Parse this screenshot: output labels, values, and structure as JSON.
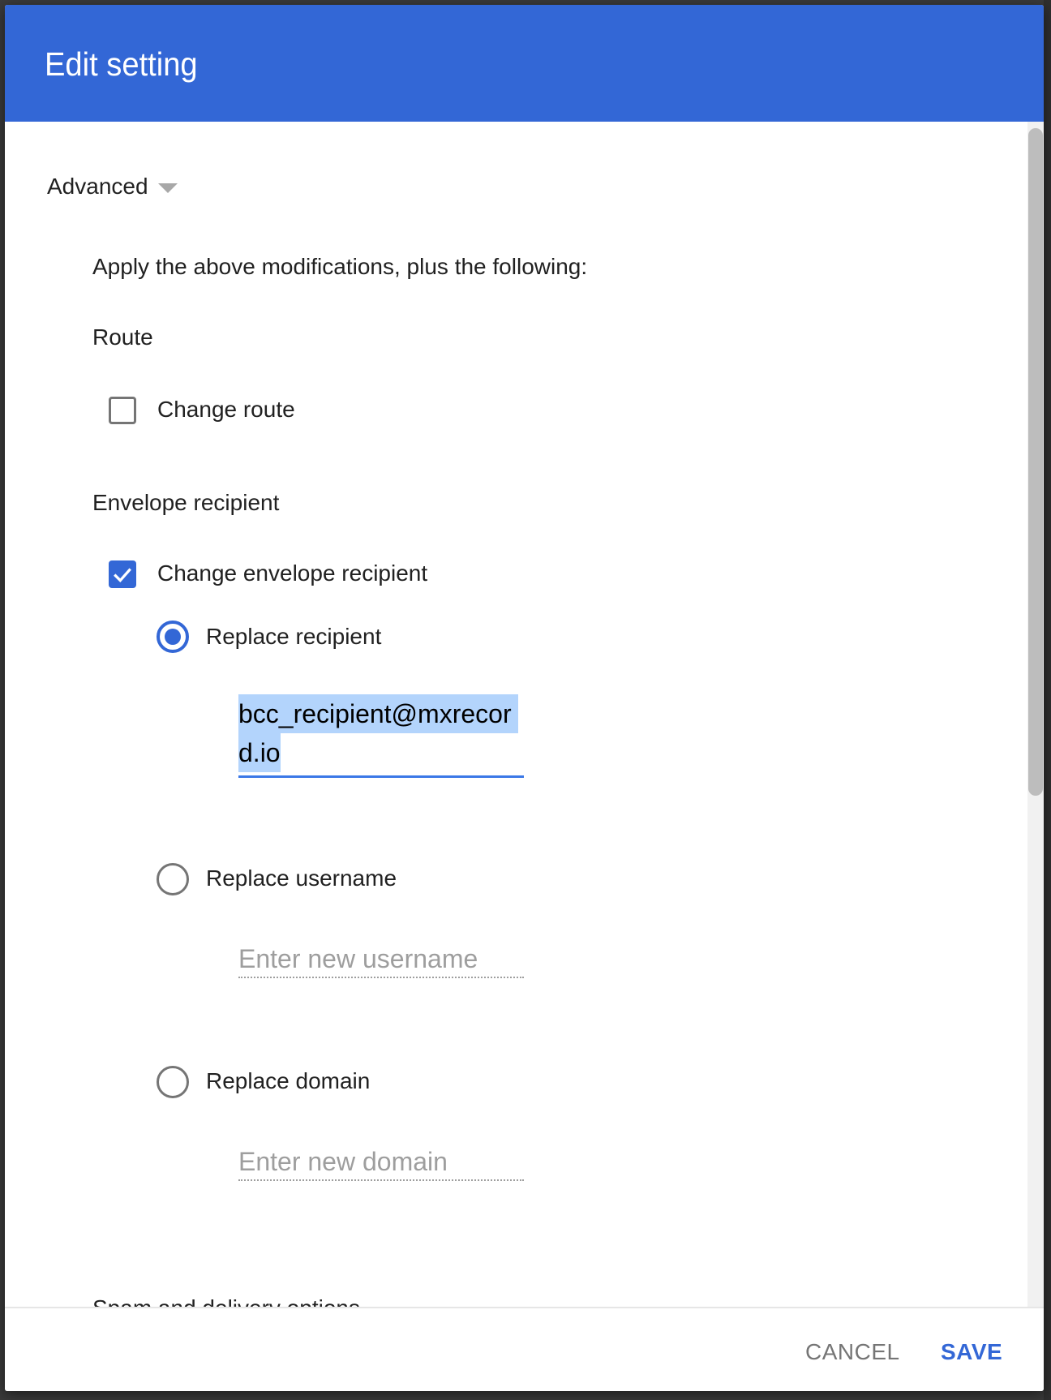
{
  "dialog": {
    "title": "Edit setting"
  },
  "advanced": {
    "label": "Advanced",
    "expand_icon": "triangle-down-icon"
  },
  "content": {
    "intro": "Apply the above modifications, plus the following:",
    "route": {
      "heading": "Route",
      "change_route": {
        "label": "Change route",
        "checked": false
      }
    },
    "envelope_recipient": {
      "heading": "Envelope recipient",
      "change_envelope_recipient": {
        "label": "Change envelope recipient",
        "checked": true
      },
      "options": [
        {
          "label": "Replace recipient",
          "selected": true,
          "value_line1": "bcc_recipient@mxrecor",
          "value_line2": "d.io",
          "value": "bcc_recipient@mxrecord.io"
        },
        {
          "label": "Replace username",
          "selected": false,
          "placeholder": "Enter new username"
        },
        {
          "label": "Replace domain",
          "selected": false,
          "placeholder": "Enter new domain"
        }
      ]
    },
    "next_section_heading": "Spam and delivery options"
  },
  "footer": {
    "cancel_label": "CANCEL",
    "save_label": "SAVE"
  },
  "colors": {
    "header": "#3367d6",
    "accent": "#3367d6",
    "selection": "#b3d4fc",
    "cancel_text": "#757575"
  }
}
